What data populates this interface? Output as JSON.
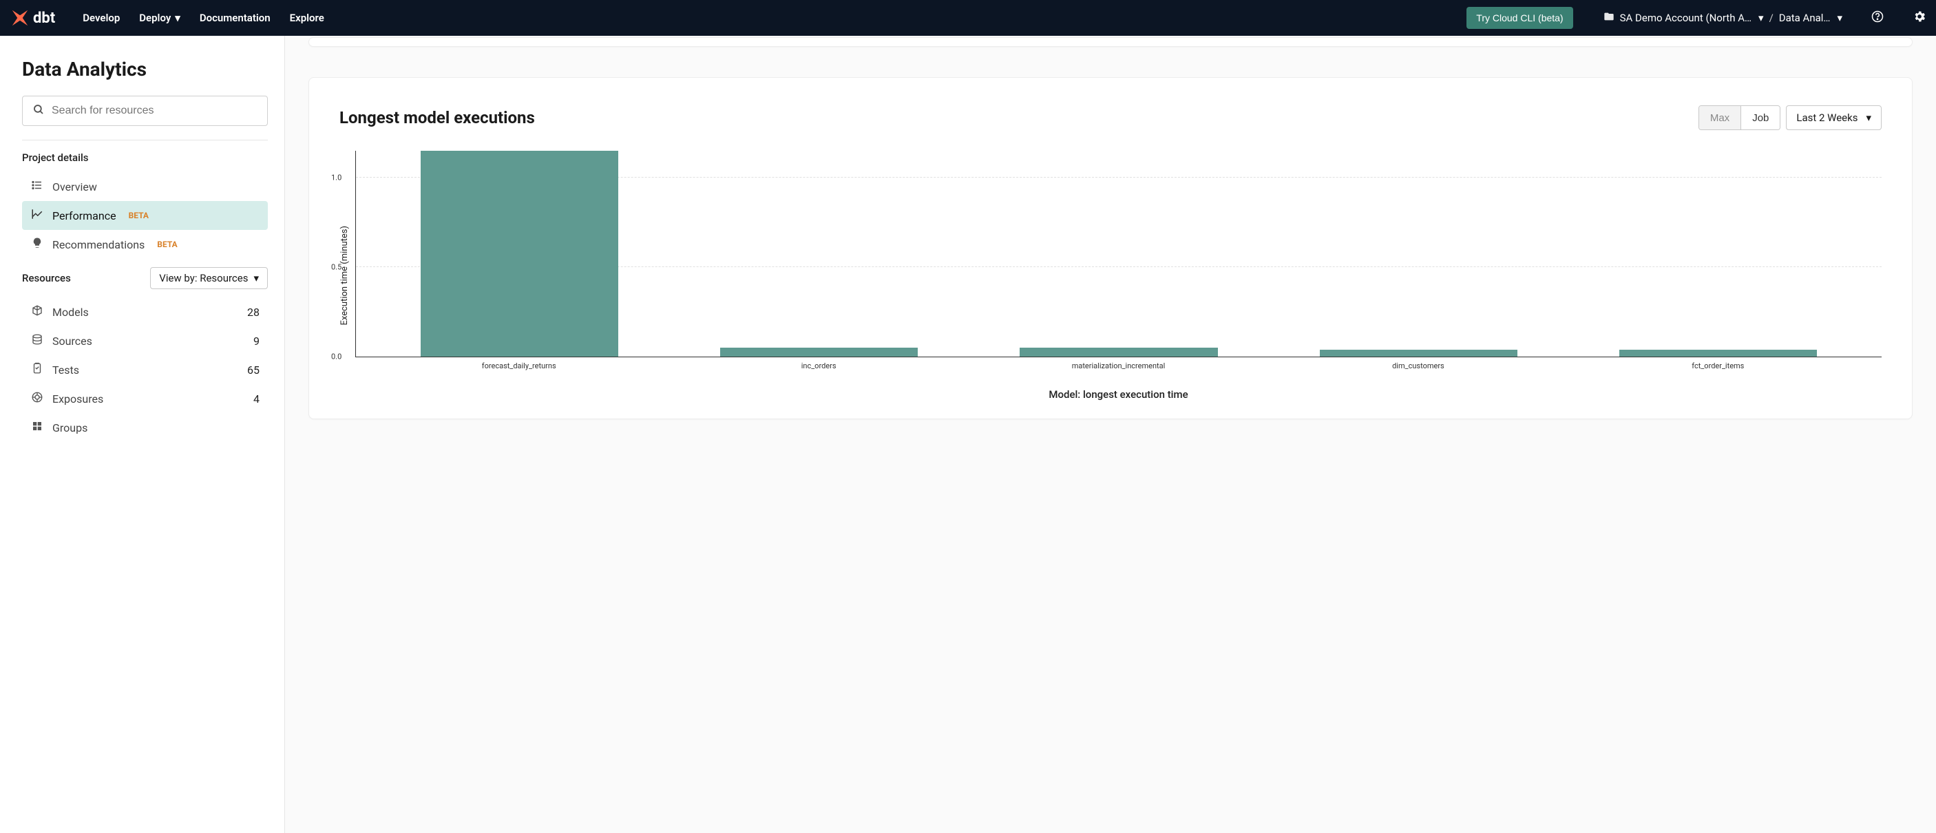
{
  "topnav": {
    "brand": "dbt",
    "links": {
      "develop": "Develop",
      "deploy": "Deploy",
      "documentation": "Documentation",
      "explore": "Explore"
    },
    "cta": "Try Cloud CLI (beta)",
    "account": "SA Demo Account (North A…",
    "project": "Data Anal…"
  },
  "sidebar": {
    "title": "Data Analytics",
    "search_placeholder": "Search for resources",
    "section_project": "Project details",
    "items": {
      "overview": "Overview",
      "performance": "Performance",
      "recommendations": "Recommendations"
    },
    "badge_beta": "BETA",
    "section_resources": "Resources",
    "view_by": "View by: Resources",
    "resources": [
      {
        "label": "Models",
        "count": "28"
      },
      {
        "label": "Sources",
        "count": "9"
      },
      {
        "label": "Tests",
        "count": "65"
      },
      {
        "label": "Exposures",
        "count": "4"
      },
      {
        "label": "Groups",
        "count": ""
      }
    ]
  },
  "card": {
    "title": "Longest model executions",
    "toggle_max": "Max",
    "toggle_job": "Job",
    "range": "Last 2 Weeks"
  },
  "chart_data": {
    "type": "bar",
    "title": "Longest model executions",
    "ylabel": "Execution time (minutes)",
    "xlabel": "Model: longest execution time",
    "ylim": [
      0,
      1.15
    ],
    "yticks": [
      0.0,
      0.5,
      1.0
    ],
    "categories": [
      "forecast_daily_returns",
      "inc_orders",
      "materialization_incremental",
      "dim_customers",
      "fct_order_items"
    ],
    "values": [
      1.15,
      0.05,
      0.05,
      0.04,
      0.04
    ],
    "color": "#5f9a91"
  }
}
